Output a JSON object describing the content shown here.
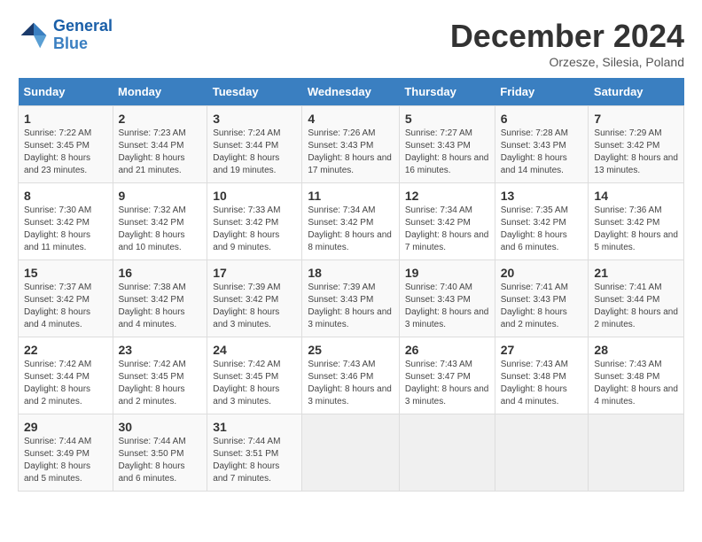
{
  "header": {
    "logo_general": "General",
    "logo_blue": "Blue",
    "month": "December 2024",
    "location": "Orzesze, Silesia, Poland"
  },
  "columns": [
    "Sunday",
    "Monday",
    "Tuesday",
    "Wednesday",
    "Thursday",
    "Friday",
    "Saturday"
  ],
  "weeks": [
    [
      {
        "day": "1",
        "sunrise": "7:22 AM",
        "sunset": "3:45 PM",
        "daylight": "8 hours and 23 minutes."
      },
      {
        "day": "2",
        "sunrise": "7:23 AM",
        "sunset": "3:44 PM",
        "daylight": "8 hours and 21 minutes."
      },
      {
        "day": "3",
        "sunrise": "7:24 AM",
        "sunset": "3:44 PM",
        "daylight": "8 hours and 19 minutes."
      },
      {
        "day": "4",
        "sunrise": "7:26 AM",
        "sunset": "3:43 PM",
        "daylight": "8 hours and 17 minutes."
      },
      {
        "day": "5",
        "sunrise": "7:27 AM",
        "sunset": "3:43 PM",
        "daylight": "8 hours and 16 minutes."
      },
      {
        "day": "6",
        "sunrise": "7:28 AM",
        "sunset": "3:43 PM",
        "daylight": "8 hours and 14 minutes."
      },
      {
        "day": "7",
        "sunrise": "7:29 AM",
        "sunset": "3:42 PM",
        "daylight": "8 hours and 13 minutes."
      }
    ],
    [
      {
        "day": "8",
        "sunrise": "7:30 AM",
        "sunset": "3:42 PM",
        "daylight": "8 hours and 11 minutes."
      },
      {
        "day": "9",
        "sunrise": "7:32 AM",
        "sunset": "3:42 PM",
        "daylight": "8 hours and 10 minutes."
      },
      {
        "day": "10",
        "sunrise": "7:33 AM",
        "sunset": "3:42 PM",
        "daylight": "8 hours and 9 minutes."
      },
      {
        "day": "11",
        "sunrise": "7:34 AM",
        "sunset": "3:42 PM",
        "daylight": "8 hours and 8 minutes."
      },
      {
        "day": "12",
        "sunrise": "7:34 AM",
        "sunset": "3:42 PM",
        "daylight": "8 hours and 7 minutes."
      },
      {
        "day": "13",
        "sunrise": "7:35 AM",
        "sunset": "3:42 PM",
        "daylight": "8 hours and 6 minutes."
      },
      {
        "day": "14",
        "sunrise": "7:36 AM",
        "sunset": "3:42 PM",
        "daylight": "8 hours and 5 minutes."
      }
    ],
    [
      {
        "day": "15",
        "sunrise": "7:37 AM",
        "sunset": "3:42 PM",
        "daylight": "8 hours and 4 minutes."
      },
      {
        "day": "16",
        "sunrise": "7:38 AM",
        "sunset": "3:42 PM",
        "daylight": "8 hours and 4 minutes."
      },
      {
        "day": "17",
        "sunrise": "7:39 AM",
        "sunset": "3:42 PM",
        "daylight": "8 hours and 3 minutes."
      },
      {
        "day": "18",
        "sunrise": "7:39 AM",
        "sunset": "3:43 PM",
        "daylight": "8 hours and 3 minutes."
      },
      {
        "day": "19",
        "sunrise": "7:40 AM",
        "sunset": "3:43 PM",
        "daylight": "8 hours and 3 minutes."
      },
      {
        "day": "20",
        "sunrise": "7:41 AM",
        "sunset": "3:43 PM",
        "daylight": "8 hours and 2 minutes."
      },
      {
        "day": "21",
        "sunrise": "7:41 AM",
        "sunset": "3:44 PM",
        "daylight": "8 hours and 2 minutes."
      }
    ],
    [
      {
        "day": "22",
        "sunrise": "7:42 AM",
        "sunset": "3:44 PM",
        "daylight": "8 hours and 2 minutes."
      },
      {
        "day": "23",
        "sunrise": "7:42 AM",
        "sunset": "3:45 PM",
        "daylight": "8 hours and 2 minutes."
      },
      {
        "day": "24",
        "sunrise": "7:42 AM",
        "sunset": "3:45 PM",
        "daylight": "8 hours and 3 minutes."
      },
      {
        "day": "25",
        "sunrise": "7:43 AM",
        "sunset": "3:46 PM",
        "daylight": "8 hours and 3 minutes."
      },
      {
        "day": "26",
        "sunrise": "7:43 AM",
        "sunset": "3:47 PM",
        "daylight": "8 hours and 3 minutes."
      },
      {
        "day": "27",
        "sunrise": "7:43 AM",
        "sunset": "3:48 PM",
        "daylight": "8 hours and 4 minutes."
      },
      {
        "day": "28",
        "sunrise": "7:43 AM",
        "sunset": "3:48 PM",
        "daylight": "8 hours and 4 minutes."
      }
    ],
    [
      {
        "day": "29",
        "sunrise": "7:44 AM",
        "sunset": "3:49 PM",
        "daylight": "8 hours and 5 minutes."
      },
      {
        "day": "30",
        "sunrise": "7:44 AM",
        "sunset": "3:50 PM",
        "daylight": "8 hours and 6 minutes."
      },
      {
        "day": "31",
        "sunrise": "7:44 AM",
        "sunset": "3:51 PM",
        "daylight": "8 hours and 7 minutes."
      },
      null,
      null,
      null,
      null
    ]
  ]
}
